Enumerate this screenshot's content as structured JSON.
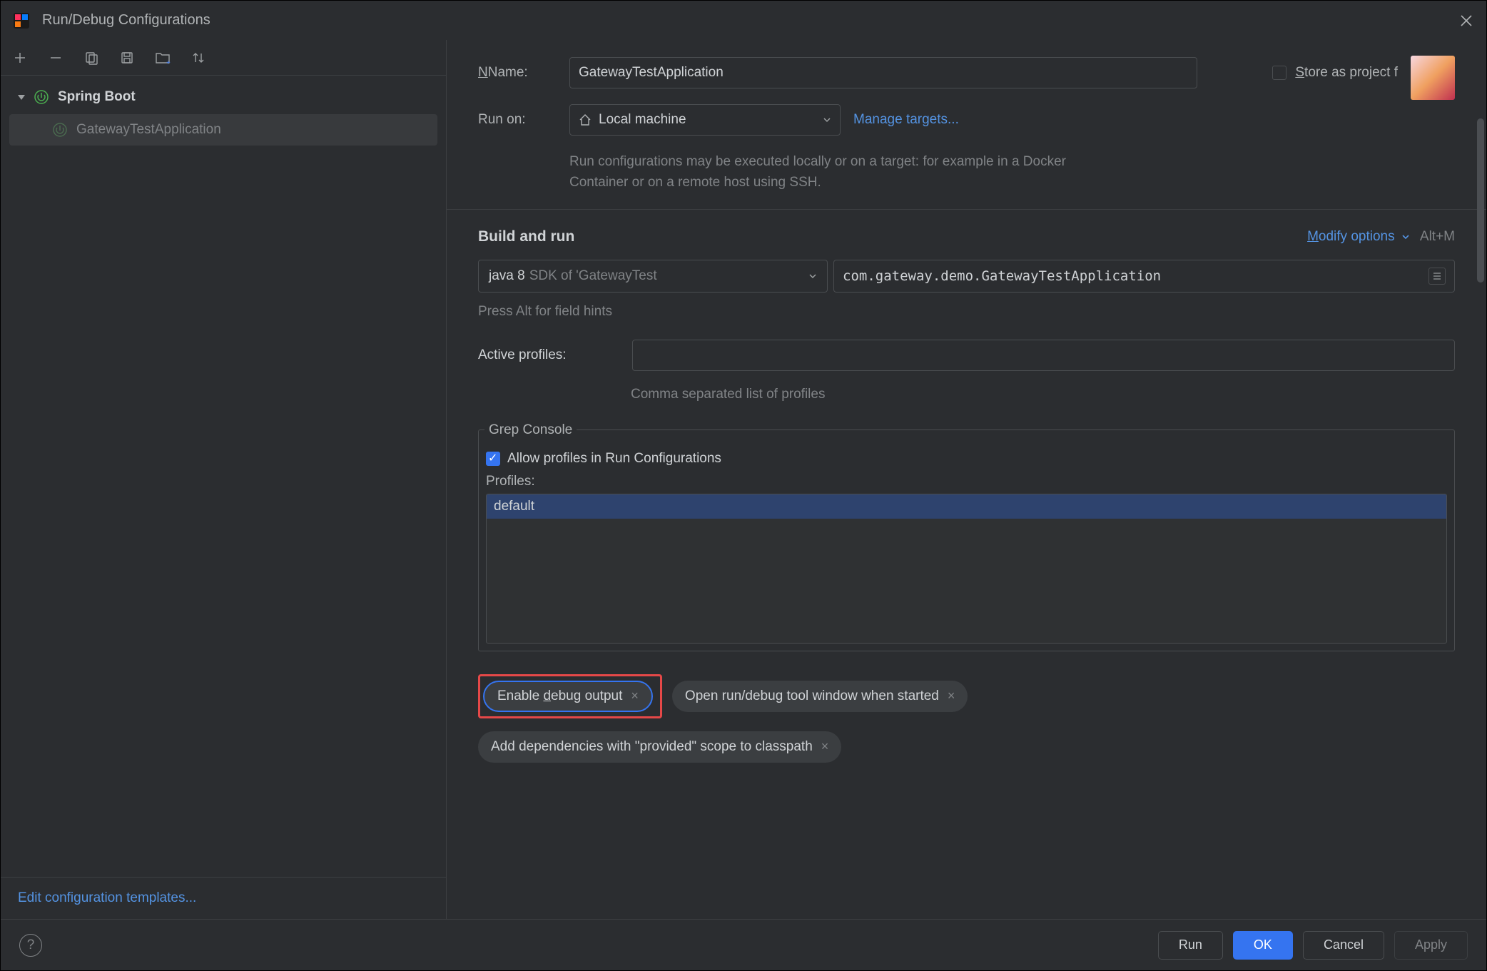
{
  "title": "Run/Debug Configurations",
  "sidebar": {
    "group_label": "Spring Boot",
    "items": [
      {
        "label": "GatewayTestApplication"
      }
    ],
    "edit_templates": "Edit configuration templates..."
  },
  "form": {
    "name_label": "Name:",
    "name_value": "GatewayTestApplication",
    "store_label": "Store as project f",
    "run_on_label": "Run on:",
    "run_on_value": "Local machine",
    "manage_targets": "Manage targets...",
    "run_on_helper": "Run configurations may be executed locally or on a target: for example in a Docker Container or on a remote host using SSH."
  },
  "build": {
    "section_title": "Build and run",
    "modify_label": "Modify options",
    "shortcut": "Alt+M",
    "jdk_value": "java 8",
    "jdk_placeholder": "SDK of 'GatewayTest",
    "main_class": "com.gateway.demo.GatewayTestApplication",
    "hint": "Press Alt for field hints",
    "active_profiles_label": "Active profiles:",
    "active_profiles_value": "",
    "active_profiles_helper": "Comma separated list of profiles"
  },
  "grep": {
    "legend": "Grep Console",
    "allow_label": "Allow profiles in Run Configurations",
    "profiles_label": "Profiles:",
    "profiles": [
      "default"
    ]
  },
  "pills": {
    "enable_debug": "Enable debug output",
    "open_tool": "Open run/debug tool window when started",
    "add_deps": "Add dependencies with \"provided\" scope to classpath"
  },
  "footer": {
    "run": "Run",
    "ok": "OK",
    "cancel": "Cancel",
    "apply": "Apply"
  }
}
